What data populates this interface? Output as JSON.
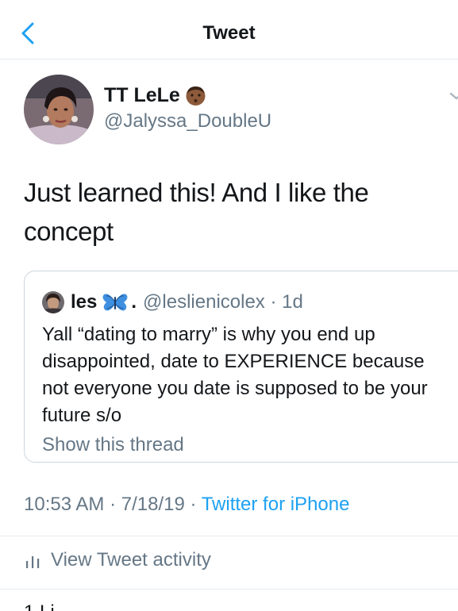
{
  "nav": {
    "title": "Tweet"
  },
  "tweet": {
    "author_name": "TT LeLe",
    "author_handle": "@Jalyssa_DoubleU",
    "text": "Just learned this! And I like the concept",
    "timestamp": "10:53 AM · 7/18/19 · ",
    "source": "Twitter for iPhone"
  },
  "quoted": {
    "author_name": "les",
    "separator": ".",
    "author_handle": "@leslienicolex · 1d",
    "text": "Yall “dating to marry” is why you end up disappointed, date to EXPERIENCE because not everyone you date is supposed to be your future s/o",
    "show_thread": "Show this thread"
  },
  "actions": {
    "activity_label": "View Tweet activity"
  },
  "colors": {
    "accent": "#1da1f2",
    "secondary_text": "#657786",
    "border": "#ccd6dd"
  },
  "icons": [
    "back-chevron-icon",
    "emoji-face-icon",
    "chevron-down-icon",
    "butterfly-emoji-icon",
    "activity-bars-icon"
  ]
}
